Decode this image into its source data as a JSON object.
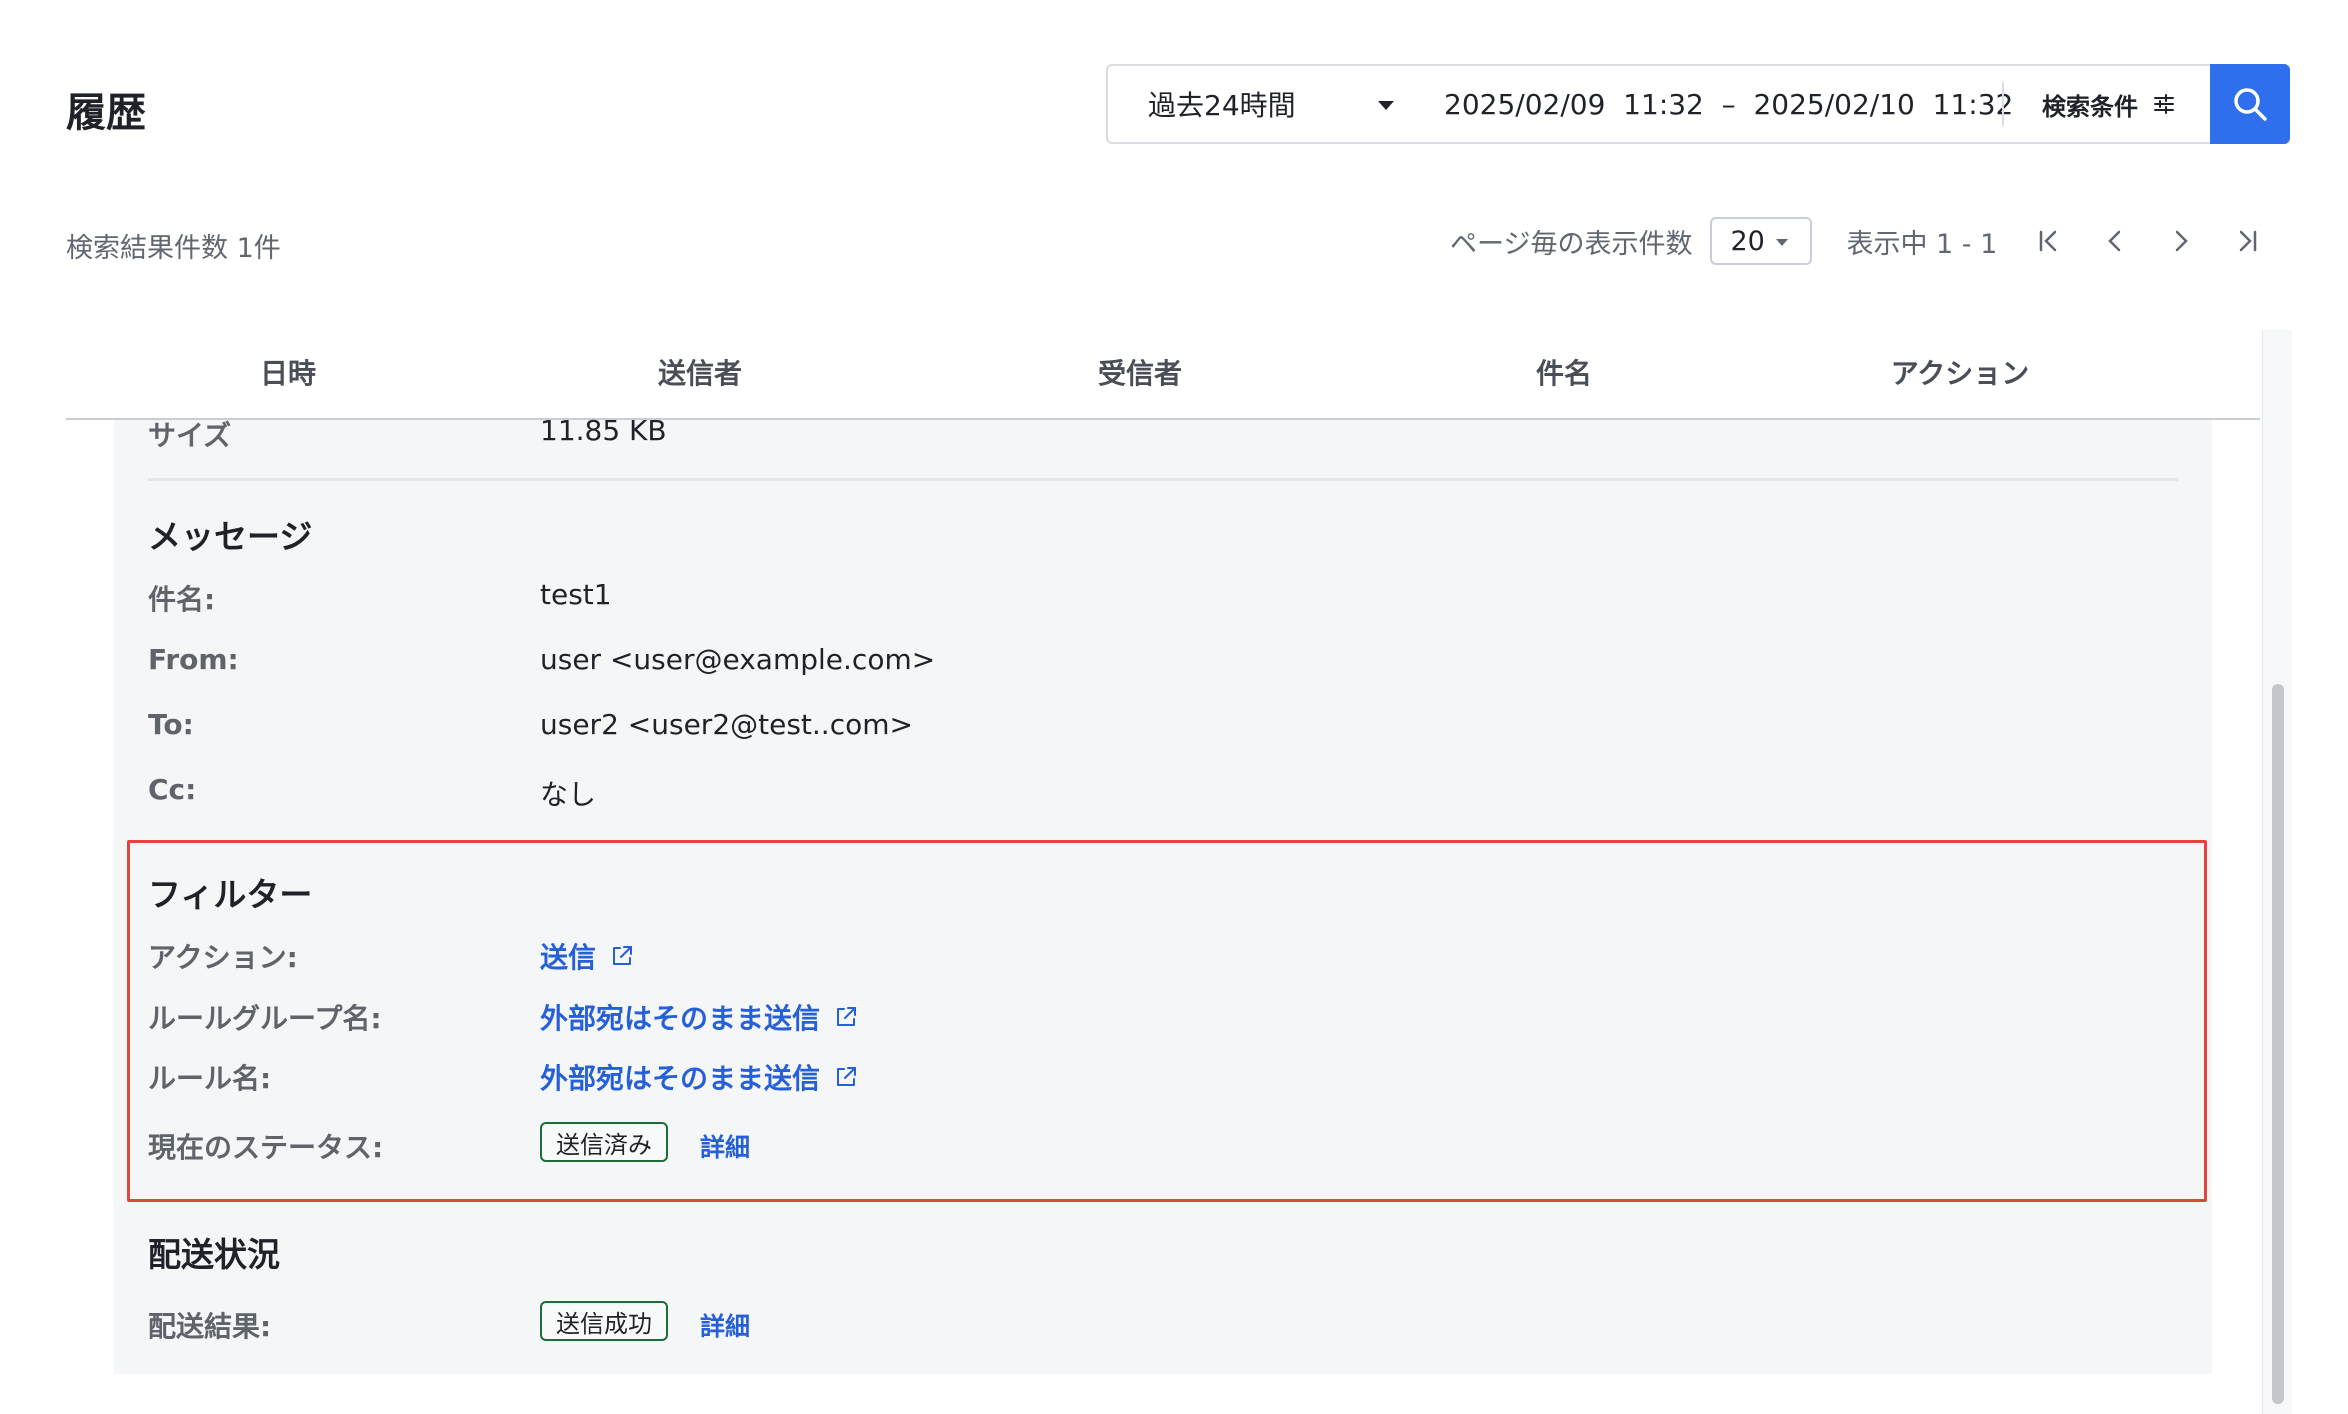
{
  "header": {
    "title": "履歴",
    "period": "過去24時間",
    "range": "2025/02/09  11:32  –  2025/02/10  11:32",
    "conditions_label": "検索条件"
  },
  "results": {
    "count_label": "検索結果件数 1件",
    "per_page_label": "ページ毎の表示件数",
    "per_page_value": "20",
    "showing": "表示中 1 - 1"
  },
  "table": {
    "headers": [
      "日時",
      "送信者",
      "受信者",
      "件名",
      "アクション"
    ]
  },
  "detail": {
    "size": {
      "label": "サイズ",
      "value": "11.85 KB"
    },
    "message": {
      "title": "メッセージ",
      "rows": [
        {
          "label": "件名:",
          "value": "test1"
        },
        {
          "label": "From:",
          "value": "user <user@example.com>"
        },
        {
          "label": "To:",
          "value": "user2 <user2@test..com>"
        },
        {
          "label": "Cc:",
          "value": "なし"
        }
      ]
    },
    "filter": {
      "title": "フィルター",
      "action": {
        "label": "アクション:",
        "value": "送信"
      },
      "rule_group": {
        "label": "ルールグループ名:",
        "value": "外部宛はそのまま送信"
      },
      "rule": {
        "label": "ルール名:",
        "value": "外部宛はそのまま送信"
      },
      "status": {
        "label": "現在のステータス:",
        "badge": "送信済み",
        "detail": "詳細"
      }
    },
    "delivery": {
      "title": "配送状況",
      "result": {
        "label": "配送結果:",
        "badge": "送信成功",
        "detail": "詳細"
      }
    }
  },
  "colors": {
    "accent": "#2f6fed",
    "link": "#2660d8",
    "highlight": "#e0463c",
    "badge_border": "#1e6b3a"
  }
}
